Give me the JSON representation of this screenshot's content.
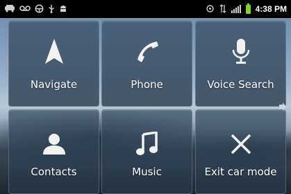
{
  "status_bar": {
    "time": "4:38 PM",
    "left_icons": [
      "car-mode-icon",
      "voicemail-icon",
      "steering-wheel-icon",
      "usb-icon",
      "android-debug-icon"
    ],
    "right_icons": [
      "gps-icon",
      "3g-data-icon",
      "signal-icon",
      "battery-icon"
    ]
  },
  "tiles": [
    {
      "label": "Navigate",
      "icon": "navigation-arrow-icon"
    },
    {
      "label": "Phone",
      "icon": "phone-icon"
    },
    {
      "label": "Voice Search",
      "icon": "microphone-icon"
    },
    {
      "label": "Contacts",
      "icon": "contact-person-icon"
    },
    {
      "label": "Music",
      "icon": "music-note-icon"
    },
    {
      "label": "Exit car mode",
      "icon": "close-x-icon"
    }
  ],
  "colors": {
    "status_bar_bg": "#000000",
    "battery": "#7fd321",
    "tile_text": "#ffffff"
  }
}
